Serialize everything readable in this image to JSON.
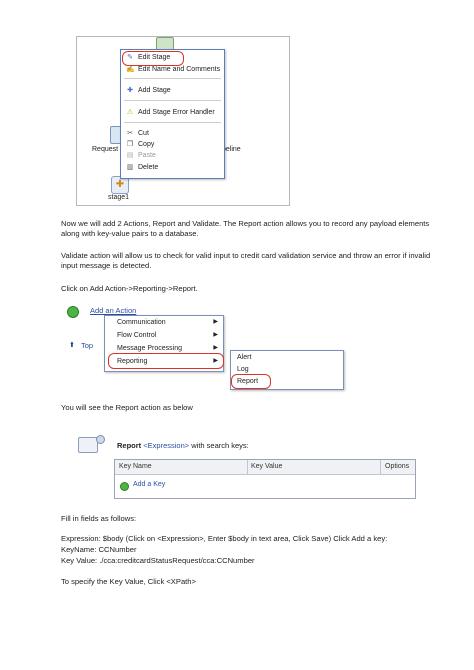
{
  "context_menu": {
    "items": [
      {
        "icon": "edit-stage-icon",
        "label": "Edit Stage"
      },
      {
        "icon": "edit-name-icon",
        "label": "Edit Name and Comments"
      },
      {
        "icon": "add-stage-icon",
        "label": "Add Stage"
      },
      {
        "icon": "warning-icon",
        "label": "Add Stage Error Handler"
      },
      {
        "icon": "cut-icon",
        "label": "Cut"
      },
      {
        "icon": "copy-icon",
        "label": "Copy"
      },
      {
        "icon": "paste-icon",
        "label": "Paste"
      },
      {
        "icon": "delete-icon",
        "label": "Delete"
      }
    ],
    "background_left_text": "Request",
    "background_right_text": "peline",
    "stage_label": "stage1",
    "colors": {
      "highlight": "#d9342b",
      "menu_border": "#5a7dbb"
    }
  },
  "text": {
    "p1": "Now we will add 2 Actions, Report and Validate.  The Report action allows you to record any payload elements along with key-value pairs to a database.",
    "p2": "Validate action will allow us to check for valid input to credit card validation service and throw an error if invalid input message is detected.",
    "p3": "Click on Add Action->Reporting->Report.",
    "p4": "You will see the Report action as below",
    "p5": "Fill in fields as follows:",
    "p6a": "Expression: $body (Click on <Expression>, Enter $body in text area, Click Save) Click Add a key:",
    "p6b": "KeyName:  CCNumber",
    "p6c": "Key Value: ./cca:creditcardStatusRequest/cca:CCNumber",
    "p7": "To specify the Key Value, Click <XPath>"
  },
  "add_action": {
    "link": "Add an Action",
    "top_link": "Top",
    "menu": [
      "Communication",
      "Flow Control",
      "Message Processing",
      "Reporting"
    ],
    "submenu": [
      "Alert",
      "Log",
      "Report"
    ]
  },
  "report_action": {
    "title": "Report",
    "expression": "<Expression>",
    "suffix": "with search keys:",
    "columns": [
      "Key Name",
      "Key Value",
      "Options"
    ],
    "add_key": "Add a Key"
  }
}
